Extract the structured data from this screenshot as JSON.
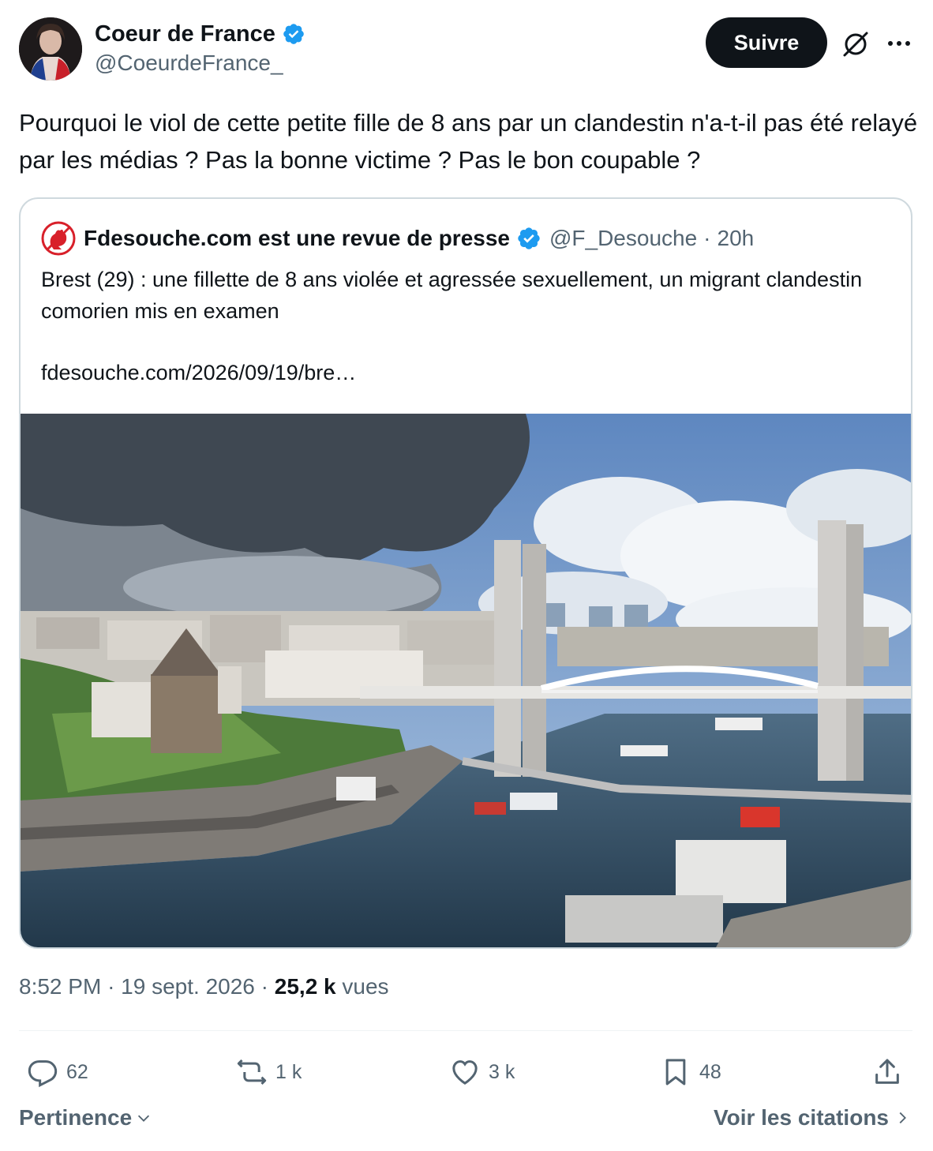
{
  "author": {
    "name": "Coeur de France",
    "handle": "@CoeurdeFrance_"
  },
  "follow_label": "Suivre",
  "tweet_text": "Pourquoi le viol de cette petite fille de 8 ans par un clandestin n'a-t-il pas été relayé par les médias ? Pas la bonne victime ? Pas le bon coupable ?",
  "quote": {
    "name": "Fdesouche.com est une revue de presse",
    "handle": "@F_Desouche",
    "separator": "·",
    "time": "20h",
    "text": "Brest (29) : une fillette de 8 ans violée et agressée sexuellement, un migrant clandestin comorien mis en examen",
    "link": "fdesouche.com/2026/09/19/bre…"
  },
  "meta": {
    "time": "8:52 PM",
    "separator": "·",
    "date": "19 sept. 2026",
    "views_count": "25,2 k",
    "views_label": "vues"
  },
  "actions": {
    "replies": "62",
    "reposts": "1 k",
    "likes": "3 k",
    "bookmarks": "48"
  },
  "footer": {
    "sort_label": "Pertinence",
    "quotes_label": "Voir les citations"
  },
  "colors": {
    "verified": "#1d9bf0",
    "text": "#0f1419",
    "secondary": "#536471",
    "border": "#cfd9de",
    "button": "#0f1419"
  },
  "icons": [
    "verified-badge-icon",
    "grok-icon",
    "more-icon",
    "reply-icon",
    "repost-icon",
    "like-icon",
    "bookmark-icon",
    "share-icon",
    "chevron-down-icon",
    "chevron-right-icon",
    "rooster-logo-icon"
  ]
}
